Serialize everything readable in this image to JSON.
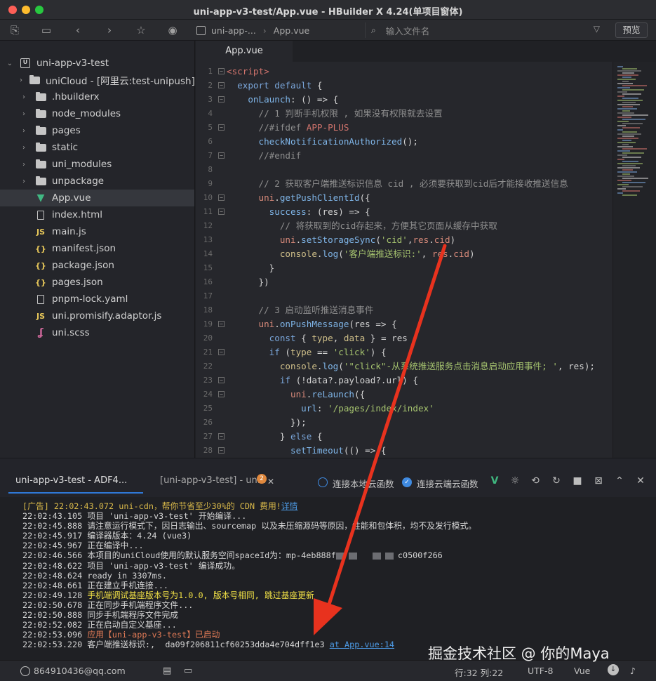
{
  "window": {
    "title": "uni-app-v3-test/App.vue - HBuilder X 4.24(单项目窗体)"
  },
  "toolbar": {
    "crumb_project": "uni-app-...",
    "crumb_file": "App.vue",
    "search_placeholder": "输入文件名",
    "preview_label": "预览"
  },
  "sidebar": {
    "project": "uni-app-v3-test",
    "items": [
      {
        "label": "uniCloud - [阿里云:test-unipush]",
        "type": "folder"
      },
      {
        "label": ".hbuilderx",
        "type": "folder"
      },
      {
        "label": "node_modules",
        "type": "folder"
      },
      {
        "label": "pages",
        "type": "folder"
      },
      {
        "label": "static",
        "type": "folder"
      },
      {
        "label": "uni_modules",
        "type": "folder"
      },
      {
        "label": "unpackage",
        "type": "folder"
      },
      {
        "label": "App.vue",
        "type": "vue"
      },
      {
        "label": "index.html",
        "type": "file"
      },
      {
        "label": "main.js",
        "type": "js"
      },
      {
        "label": "manifest.json",
        "type": "json"
      },
      {
        "label": "package.json",
        "type": "json"
      },
      {
        "label": "pages.json",
        "type": "json"
      },
      {
        "label": "pnpm-lock.yaml",
        "type": "file"
      },
      {
        "label": "uni.promisify.adaptor.js",
        "type": "js"
      },
      {
        "label": "uni.scss",
        "type": "scss"
      }
    ]
  },
  "editor": {
    "tab_label": "App.vue",
    "lines": [
      {
        "n": "1",
        "text": "<script>"
      },
      {
        "n": "2",
        "text": "  export default {"
      },
      {
        "n": "3",
        "text": "    onLaunch: () => {"
      },
      {
        "n": "4",
        "text": "      // 1 判断手机权限 , 如果没有权限就去设置"
      },
      {
        "n": "5",
        "text": "      //#ifdef APP-PLUS"
      },
      {
        "n": "6",
        "text": "      checkNotificationAuthorized();"
      },
      {
        "n": "7",
        "text": "      //#endif"
      },
      {
        "n": "8",
        "text": ""
      },
      {
        "n": "9",
        "text": "      // 2 获取客户端推送标识信息 cid , 必须要获取到cid后才能接收推送信息"
      },
      {
        "n": "10",
        "text": "      uni.getPushClientId({"
      },
      {
        "n": "11",
        "text": "        success: (res) => {"
      },
      {
        "n": "12",
        "text": "          // 将获取到的cid存起来，方便其它页面从缓存中获取"
      },
      {
        "n": "13",
        "text": "          uni.setStorageSync('cid',res.cid)"
      },
      {
        "n": "14",
        "text": "          console.log('客户端推送标识:', res.cid)"
      },
      {
        "n": "15",
        "text": "        }"
      },
      {
        "n": "16",
        "text": "      })"
      },
      {
        "n": "17",
        "text": ""
      },
      {
        "n": "18",
        "text": "      // 3 启动监听推送消息事件"
      },
      {
        "n": "19",
        "text": "      uni.onPushMessage(res => {"
      },
      {
        "n": "20",
        "text": "        const { type, data } = res"
      },
      {
        "n": "21",
        "text": "        if (type == 'click') {"
      },
      {
        "n": "22",
        "text": "          console.log('\"click\"-从系统推送服务点击消息启动应用事件; ', res);"
      },
      {
        "n": "23",
        "text": "          if (!data?.payload?.url) {"
      },
      {
        "n": "24",
        "text": "            uni.reLaunch({"
      },
      {
        "n": "25",
        "text": "              url: '/pages/index/index'"
      },
      {
        "n": "26",
        "text": "            });"
      },
      {
        "n": "27",
        "text": "          } else {"
      },
      {
        "n": "28",
        "text": "            setTimeout(() => {"
      }
    ]
  },
  "console": {
    "tab1": "uni-app-v3-test - ADF4...",
    "tab2": "[uni-app-v3-test] - un...",
    "tab2_badge": "2",
    "local_fn_label": "连接本地云函数",
    "cloud_fn_label": "连接云端云函数",
    "logs": [
      {
        "ts": "[广告] 22:02:43.072",
        "msg": " uni-cdn，帮你节省至少30%的 CDN 费用!",
        "link": "详情",
        "style": "ad"
      },
      {
        "ts": "22:02:43.105",
        "msg": " 项目 'uni-app-v3-test' 开始编译..."
      },
      {
        "ts": "22:02:45.888",
        "msg": " 请注意运行模式下，因日志输出、sourcemap 以及未压缩源码等原因，性能和包体积，均不及发行模式。"
      },
      {
        "ts": "22:02:45.917",
        "msg": " 编译器版本：4.24 (vue3)"
      },
      {
        "ts": "22:02:45.967",
        "msg": " 正在编译中..."
      },
      {
        "ts": "22:02:46.566",
        "msg": " 本项目的uniCloud使用的默认服务空间spaceId为：mp-4eb888f",
        "tail": "c0500f266",
        "redacted": true
      },
      {
        "ts": "22:02:48.622",
        "msg": " 项目 'uni-app-v3-test' 编译成功。"
      },
      {
        "ts": "22:02:48.624",
        "msg": " ready in 3307ms."
      },
      {
        "ts": "22:02:48.661",
        "msg": " 正在建立手机连接..."
      },
      {
        "ts": "22:02:49.128",
        "msg": " 手机端调试基座版本号为1.0.0, 版本号相同, 跳过基座更新",
        "style": "yellow"
      },
      {
        "ts": "22:02:50.678",
        "msg": " 正在同步手机端程序文件..."
      },
      {
        "ts": "22:02:50.888",
        "msg": " 同步手机端程序文件完成"
      },
      {
        "ts": "22:02:52.082",
        "msg": " 正在启动自定义基座..."
      },
      {
        "ts": "22:02:53.096",
        "msg": " 应用【uni-app-v3-test】已启动",
        "style": "orange"
      },
      {
        "ts": "22:02:53.220",
        "msg": " 客户端推送标识:,  da09f206811cf60253dda4e704dff1e3 ",
        "link": "at App.vue:14"
      }
    ]
  },
  "statusbar": {
    "user": "864910436@qq.com",
    "position": "行:32  列:22",
    "encoding": "UTF-8",
    "language": "Vue"
  },
  "watermark": "掘金技术社区 @ 你的Maya",
  "colors": {
    "accent": "#2f78d6",
    "arrow": "#e8321e"
  }
}
